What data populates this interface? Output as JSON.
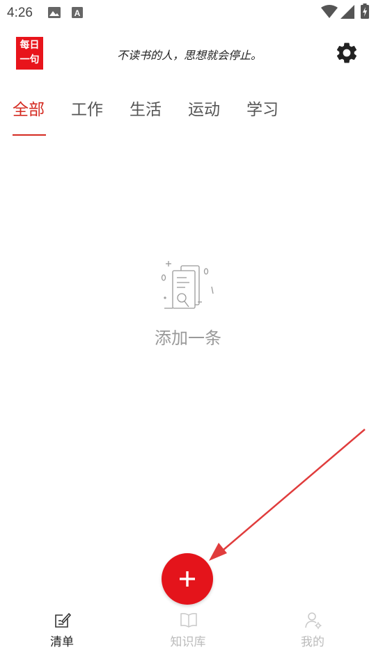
{
  "status_bar": {
    "time": "4:26"
  },
  "header": {
    "logo_line1": "每日",
    "logo_line2": "一句",
    "quote": "不读书的人，思想就会停止。"
  },
  "tabs": [
    {
      "label": "全部",
      "active": true
    },
    {
      "label": "工作",
      "active": false
    },
    {
      "label": "生活",
      "active": false
    },
    {
      "label": "运动",
      "active": false
    },
    {
      "label": "学习",
      "active": false
    }
  ],
  "empty_state": {
    "label": "添加一条"
  },
  "fab": {
    "icon": "plus-icon"
  },
  "bottom_nav": [
    {
      "label": "清单",
      "icon": "checklist-icon",
      "active": true
    },
    {
      "label": "知识库",
      "icon": "book-icon",
      "active": false
    },
    {
      "label": "我的",
      "icon": "user-settings-icon",
      "active": false
    }
  ],
  "colors": {
    "accent": "#d42a20",
    "fab": "#e4141b",
    "logo": "#e8141b",
    "annotation_arrow": "#e03c3c"
  }
}
